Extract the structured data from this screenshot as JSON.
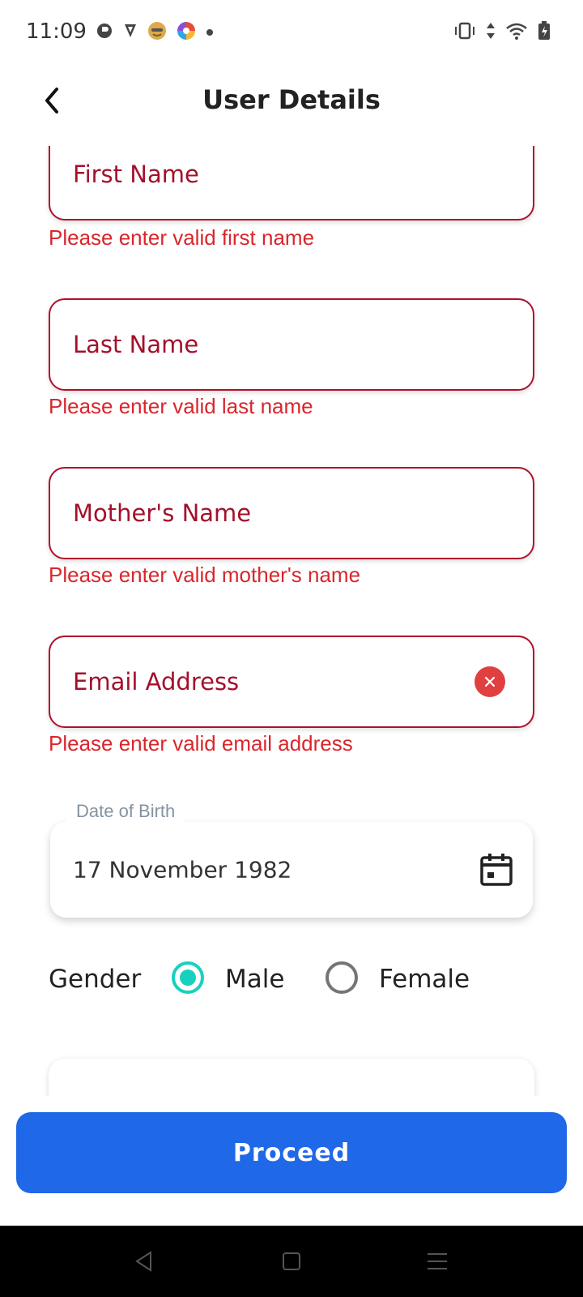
{
  "status_bar": {
    "time": "11:09"
  },
  "app_bar": {
    "title": "User Details"
  },
  "form": {
    "first_name": {
      "placeholder": "First Name",
      "error": "Please enter valid first name"
    },
    "last_name": {
      "placeholder": "Last Name",
      "error": "Please enter valid last name"
    },
    "mother_name": {
      "placeholder": "Mother's Name",
      "error": "Please enter valid mother's name"
    },
    "email": {
      "placeholder": "Email Address",
      "error": "Please enter valid email address"
    },
    "dob": {
      "label": "Date of Birth",
      "value": "17 November 1982"
    },
    "gender": {
      "label": "Gender",
      "options": [
        {
          "label": "Male",
          "checked": true
        },
        {
          "label": "Female",
          "checked": false
        }
      ]
    }
  },
  "proceed_label": "Proceed",
  "colors": {
    "error": "#d9262c",
    "field_border": "#b0102c",
    "accent_radio": "#17d1bf",
    "primary_button": "#1f68e8"
  },
  "icons": {
    "back": "back-arrow-icon",
    "clear": "clear-icon",
    "calendar": "calendar-icon",
    "nav_back": "nav-back-icon",
    "nav_home": "nav-home-icon",
    "nav_menu": "nav-menu-icon"
  }
}
